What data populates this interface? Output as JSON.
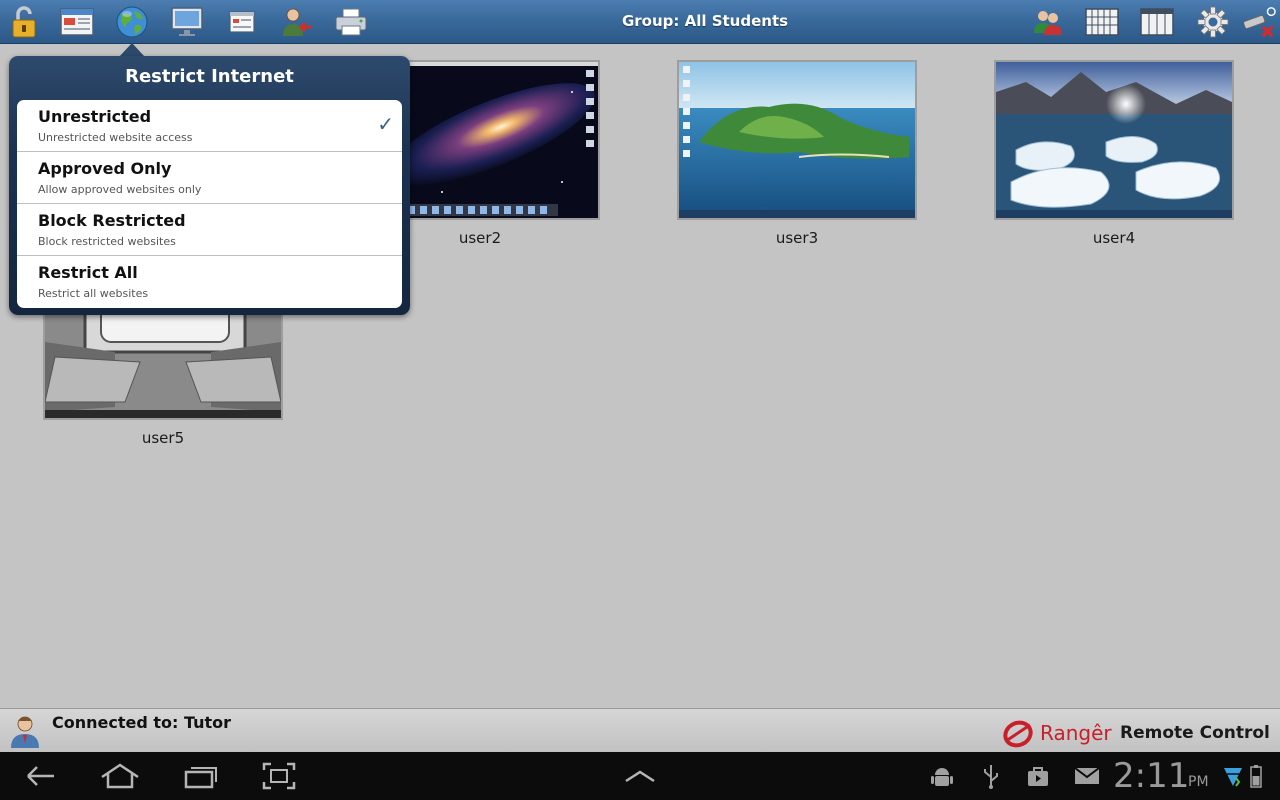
{
  "toolbar": {
    "group_title": "Group: All Students",
    "left_icons": [
      "padlock-icon",
      "browser-window-icon",
      "globe-icon",
      "monitor-icon",
      "application-icon",
      "remove-user-icon",
      "printer-icon"
    ],
    "right_icons": [
      "users-icon",
      "grid-large-icon",
      "grid-small-icon",
      "gear-icon",
      "disconnect-icon"
    ]
  },
  "popup": {
    "title": "Restrict Internet",
    "options": [
      {
        "title": "Unrestricted",
        "subtitle": "Unrestricted website access",
        "checked": true
      },
      {
        "title": "Approved Only",
        "subtitle": "Allow approved websites only",
        "checked": false
      },
      {
        "title": "Block Restricted",
        "subtitle": "Block restricted websites",
        "checked": false
      },
      {
        "title": "Restrict All",
        "subtitle": "Restrict all websites",
        "checked": false
      }
    ],
    "check_glyph": "✓"
  },
  "students": [
    {
      "name": "user2",
      "wallpaper": "galaxy"
    },
    {
      "name": "user3",
      "wallpaper": "island"
    },
    {
      "name": "user4",
      "wallpaper": "glacier"
    },
    {
      "name": "user5",
      "wallpaper": "train"
    }
  ],
  "status": {
    "connected_text": "Connected to: Tutor",
    "brand_name": "Rangêr",
    "brand_sub": "Remote Control"
  },
  "system": {
    "clock": "2:11",
    "ampm": "PM"
  },
  "colors": {
    "toolbar": "#3a6a9c",
    "popup": "#1d3352",
    "check": "#3b5f8c",
    "brand_red": "#c8202a"
  }
}
